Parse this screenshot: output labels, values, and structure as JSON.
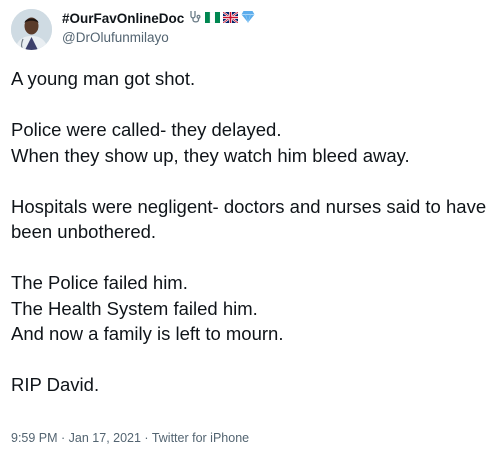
{
  "author": {
    "display_name": "#OurFavOnlineDoc",
    "handle": "@DrOlufunmilayo",
    "name_emojis": [
      "stethoscope-icon",
      "nigeria-flag-icon",
      "uk-flag-icon",
      "blue-diamond-icon"
    ]
  },
  "tweet": {
    "paragraphs": [
      "A young man got shot.",
      "Police were called- they delayed.\nWhen they show up, they watch him bleed away.",
      "Hospitals were negligent- doctors and nurses said to have been unbothered.",
      "The Police failed him.\nThe Health System failed him.\nAnd now a family is left to mourn.",
      "RIP David."
    ],
    "timestamp": "9:59 PM · Jan 17, 2021 · Twitter for iPhone"
  },
  "colors": {
    "text_primary": "#0f1419",
    "text_secondary": "#536471",
    "background": "#ffffff"
  }
}
